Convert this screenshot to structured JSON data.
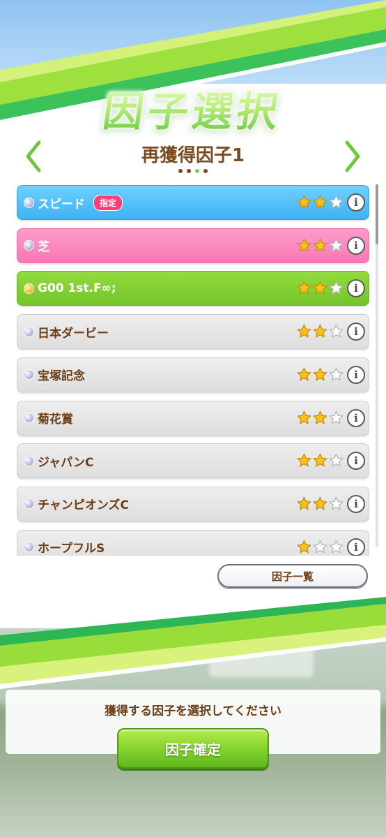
{
  "screen": {
    "title": "因子選択",
    "subtitle": "再獲得因子1",
    "page_indicator": {
      "count": 4,
      "active_index": 2
    }
  },
  "factors": [
    {
      "label": "スピード",
      "tag": "指定",
      "color": "blue",
      "bullet": "silver",
      "stars": 2,
      "max_stars": 3
    },
    {
      "label": "芝",
      "tag": "",
      "color": "pink",
      "bullet": "silver",
      "stars": 2,
      "max_stars": 3
    },
    {
      "label": "G00 1st.F∞;",
      "tag": "",
      "color": "green",
      "bullet": "gold",
      "stars": 2,
      "max_stars": 3
    },
    {
      "label": "日本ダービー",
      "tag": "",
      "color": "gray",
      "bullet": "silver",
      "stars": 2,
      "max_stars": 3
    },
    {
      "label": "宝塚記念",
      "tag": "",
      "color": "gray",
      "bullet": "silver",
      "stars": 2,
      "max_stars": 3
    },
    {
      "label": "菊花賞",
      "tag": "",
      "color": "gray",
      "bullet": "silver",
      "stars": 2,
      "max_stars": 3
    },
    {
      "label": "ジャパンC",
      "tag": "",
      "color": "gray",
      "bullet": "silver",
      "stars": 2,
      "max_stars": 3
    },
    {
      "label": "チャンピオンズC",
      "tag": "",
      "color": "gray",
      "bullet": "silver",
      "stars": 2,
      "max_stars": 3
    },
    {
      "label": "ホープフルS",
      "tag": "",
      "color": "gray",
      "bullet": "silver",
      "stars": 1,
      "max_stars": 3
    }
  ],
  "info_glyph": "i",
  "buttons": {
    "factor_list": "因子一覧",
    "confirm": "因子確定"
  },
  "prompt": "獲得する因子を選択してください",
  "icons": {
    "prev": "chevron-left-icon",
    "next": "chevron-right-icon",
    "info": "info-icon",
    "star": "star-icon"
  },
  "colors": {
    "accent_green": "#7bd24a",
    "text_brown": "#6b3e18",
    "speed_blue": "#3eb2f3",
    "turf_pink": "#f777b4",
    "unique_green": "#72c52a",
    "tag_pink": "#ff3d7a",
    "star_gold": "#f5c31c"
  }
}
